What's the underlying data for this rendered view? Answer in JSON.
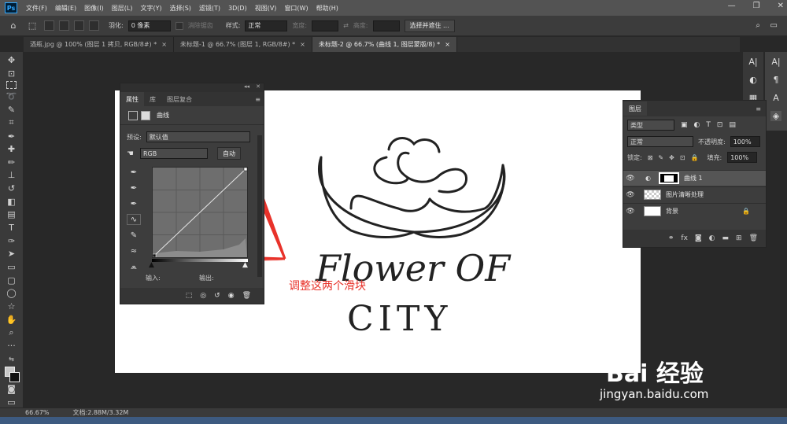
{
  "app": {
    "logo": "Ps"
  },
  "menu": [
    "文件(F)",
    "编辑(E)",
    "图像(I)",
    "图层(L)",
    "文字(Y)",
    "选择(S)",
    "滤镜(T)",
    "3D(D)",
    "视图(V)",
    "窗口(W)",
    "帮助(H)"
  ],
  "window_controls": [
    "—",
    "❐",
    "✕"
  ],
  "options": {
    "feather_label": "羽化:",
    "feather_value": "0 像素",
    "antialias_label": "消除锯齿",
    "style_label": "样式:",
    "style_value": "正常",
    "width_label": "宽度:",
    "height_label": "高度:",
    "select_mask_button": "选择并遮住 ..."
  },
  "tabs": [
    {
      "label": "酒瓶.jpg @ 100% (图层 1 拷贝, RGB/8#) *",
      "close": "×"
    },
    {
      "label": "未标题-1 @ 66.7% (图层 1, RGB/8#) *",
      "close": "×"
    },
    {
      "label": "未标题-2 @ 66.7% (曲线 1, 图层蒙版/8) *",
      "close": "×"
    }
  ],
  "properties": {
    "tabs": [
      "属性",
      "库",
      "图层复合"
    ],
    "title": "曲线",
    "preset_label": "预设:",
    "preset_value": "默认值",
    "channel_value": "RGB",
    "auto_button": "自动",
    "input_label": "输入:",
    "output_label": "输出:"
  },
  "layers": {
    "title": "图层",
    "filter_value": "类型",
    "blend_value": "正常",
    "opacity_label": "不透明度:",
    "opacity_value": "100%",
    "lock_label": "锁定:",
    "fill_label": "填充:",
    "fill_value": "100%",
    "items": [
      {
        "name": "曲线 1"
      },
      {
        "name": "图片清晰处理"
      },
      {
        "name": "背景"
      }
    ]
  },
  "canvas_text": {
    "line1": "Flower OF",
    "line2": "CITY"
  },
  "annotation": "调整这两个滑块",
  "status": {
    "zoom": "66.67%",
    "doc": "文档:2.88M/3.32M"
  },
  "watermark": {
    "brand": "Bai  经验",
    "url": "jingyan.baidu.com"
  },
  "icons": {
    "accent": "#e8322a",
    "ps_blue": "#31a8ff"
  }
}
